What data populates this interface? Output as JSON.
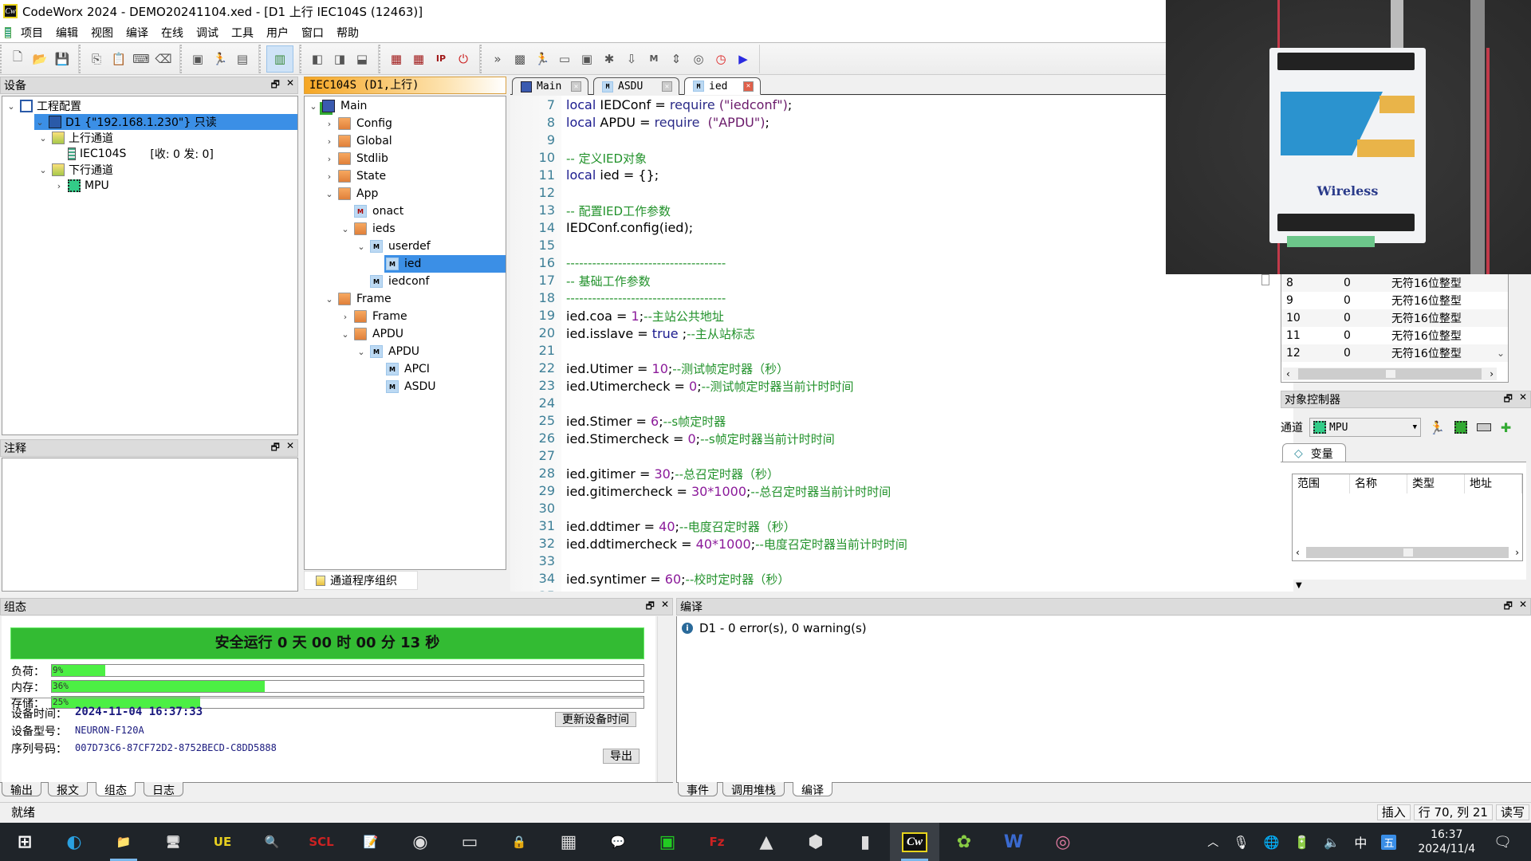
{
  "window": {
    "title": "CodeWorx 2024 - DEMO20241104.xed - [D1 上行 IEC104S (12463)]",
    "logo": "Cw"
  },
  "menu": [
    "项目",
    "编辑",
    "视图",
    "编译",
    "在线",
    "调试",
    "工具",
    "用户",
    "窗口",
    "帮助"
  ],
  "toolbar": {
    "groups": [
      [
        {
          "icon": "new-file-icon",
          "glyph": "🗋"
        },
        {
          "icon": "open-folder-icon",
          "glyph": "📂"
        },
        {
          "icon": "save-icon",
          "glyph": "💾"
        }
      ],
      [
        {
          "icon": "copy-icon",
          "glyph": "⎘"
        },
        {
          "icon": "paste-icon",
          "glyph": "📋"
        },
        {
          "icon": "keyboard-icon",
          "glyph": "⌨"
        },
        {
          "icon": "keyboard-delete-icon",
          "glyph": "⌫"
        }
      ],
      [
        {
          "icon": "add-module-icon",
          "glyph": "▣"
        },
        {
          "icon": "run-add-icon",
          "glyph": "🏃"
        },
        {
          "icon": "module-icon",
          "glyph": "▤"
        }
      ],
      [
        {
          "icon": "channel-list-icon",
          "glyph": "▥",
          "active": true
        }
      ],
      [
        {
          "icon": "layout-left-icon",
          "glyph": "◧"
        },
        {
          "icon": "layout-right-icon",
          "glyph": "◨"
        },
        {
          "icon": "layout-bottom-icon",
          "glyph": "⬓"
        }
      ],
      [
        {
          "icon": "device-connect-icon",
          "glyph": "▦"
        },
        {
          "icon": "device-disconnect-icon",
          "glyph": "▦"
        },
        {
          "icon": "ip-config-icon",
          "glyph": "IP"
        },
        {
          "icon": "power-icon",
          "glyph": "⏻"
        }
      ],
      [
        {
          "icon": "expand-icon",
          "glyph": "»"
        },
        {
          "icon": "binary-icon",
          "glyph": "▩"
        },
        {
          "icon": "run-icon",
          "glyph": "🏃"
        },
        {
          "icon": "chip-icon",
          "glyph": "▭"
        },
        {
          "icon": "chip-add-icon",
          "glyph": "▣"
        },
        {
          "icon": "debug-add-icon",
          "glyph": "✱"
        },
        {
          "icon": "download-icon",
          "glyph": "⇩"
        },
        {
          "icon": "module-m-icon",
          "glyph": "M"
        },
        {
          "icon": "step-icon",
          "glyph": "⇕"
        },
        {
          "icon": "watch-icon",
          "glyph": "◎"
        },
        {
          "icon": "clock-icon",
          "glyph": "◷"
        },
        {
          "icon": "play-icon",
          "glyph": "▶"
        }
      ]
    ]
  },
  "device_pane": {
    "title": "设备",
    "tree": [
      {
        "level": 0,
        "chev": "v",
        "icon": "project-config-icon",
        "label": "工程配置"
      },
      {
        "level": 1,
        "chev": "v",
        "icon": "device-icon",
        "label": "D1 {\"192.168.1.230\"}  只读",
        "selected": true
      },
      {
        "level": 2,
        "chev": "v",
        "icon": "uplink-folder-icon",
        "label": "上行通道"
      },
      {
        "level": 3,
        "chev": "",
        "icon": "channel-icon",
        "label": "IEC104S",
        "extra": "[收: 0 发: 0]"
      },
      {
        "level": 2,
        "chev": "v",
        "icon": "downlink-folder-icon",
        "label": "下行通道"
      },
      {
        "level": 3,
        "chev": ">",
        "icon": "mpu-chip-icon",
        "label": "MPU"
      }
    ]
  },
  "note_pane": {
    "title": "注释"
  },
  "program_pane": {
    "title": "IEC104S (D1,上行)",
    "tree": [
      {
        "level": 0,
        "chev": "v",
        "type": "main",
        "label": "Main"
      },
      {
        "level": 1,
        "chev": ">",
        "type": "folder",
        "label": "Config"
      },
      {
        "level": 1,
        "chev": ">",
        "type": "folder",
        "label": "Global"
      },
      {
        "level": 1,
        "chev": ">",
        "type": "folder",
        "label": "Stdlib"
      },
      {
        "level": 1,
        "chev": ">",
        "type": "folder",
        "label": "State"
      },
      {
        "level": 1,
        "chev": "v",
        "type": "folder",
        "label": "App"
      },
      {
        "level": 2,
        "chev": "",
        "type": "mred",
        "label": "onact"
      },
      {
        "level": 2,
        "chev": "v",
        "type": "folder",
        "label": "ieds"
      },
      {
        "level": 3,
        "chev": "v",
        "type": "m",
        "label": "userdef"
      },
      {
        "level": 4,
        "chev": "",
        "type": "m",
        "label": "ied",
        "selected": true
      },
      {
        "level": 3,
        "chev": "",
        "type": "m",
        "label": "iedconf"
      },
      {
        "level": 1,
        "chev": "v",
        "type": "folder",
        "label": "Frame"
      },
      {
        "level": 2,
        "chev": ">",
        "type": "folder",
        "label": "Frame"
      },
      {
        "level": 2,
        "chev": "v",
        "type": "folder",
        "label": "APDU"
      },
      {
        "level": 3,
        "chev": "v",
        "type": "m",
        "label": "APDU"
      },
      {
        "level": 4,
        "chev": "",
        "type": "m",
        "label": "APCI"
      },
      {
        "level": 4,
        "chev": "",
        "type": "m",
        "label": "ASDU"
      }
    ],
    "bottom_tab": "通道程序组织"
  },
  "editor": {
    "tabs": [
      {
        "label": "Main",
        "icon": "main-program-icon"
      },
      {
        "label": "ASDU",
        "icon": "module-file-icon"
      },
      {
        "label": "ied",
        "icon": "module-file-icon",
        "active": true
      }
    ],
    "lines": [
      {
        "n": 7,
        "parts": [
          [
            "kw",
            "local"
          ],
          [
            "",
            "IEDConf = "
          ],
          [
            "fn",
            "require"
          ],
          [
            "str",
            "(\"iedconf\")"
          ],
          [
            "",
            ";"
          ]
        ]
      },
      {
        "n": 8,
        "parts": [
          [
            "kw",
            "local"
          ],
          [
            "",
            "APDU = "
          ],
          [
            "fn",
            "require"
          ],
          [
            "str",
            " (\"APDU\")"
          ],
          [
            "",
            ";"
          ]
        ]
      },
      {
        "n": 9,
        "parts": []
      },
      {
        "n": 10,
        "parts": [
          [
            "cm",
            "-- 定义IED对象"
          ]
        ]
      },
      {
        "n": 11,
        "parts": [
          [
            "kw",
            "local"
          ],
          [
            "",
            "ied = {};"
          ]
        ]
      },
      {
        "n": 12,
        "parts": []
      },
      {
        "n": 13,
        "parts": [
          [
            "cm",
            "-- 配置IED工作参数"
          ]
        ]
      },
      {
        "n": 14,
        "parts": [
          [
            "",
            "IEDConf.config(ied);"
          ]
        ]
      },
      {
        "n": 15,
        "parts": []
      },
      {
        "n": 16,
        "parts": [
          [
            "cm",
            "-------------------------------------"
          ]
        ]
      },
      {
        "n": 17,
        "parts": [
          [
            "cm",
            "-- 基础工作参数"
          ]
        ]
      },
      {
        "n": 18,
        "parts": [
          [
            "cm",
            "-------------------------------------"
          ]
        ]
      },
      {
        "n": 19,
        "parts": [
          [
            "",
            "ied.coa = "
          ],
          [
            "num",
            "1"
          ],
          [
            "",
            ";"
          ],
          [
            "cm",
            "--主站公共地址"
          ]
        ]
      },
      {
        "n": 20,
        "parts": [
          [
            "",
            "ied.isslave = "
          ],
          [
            "kw",
            "true"
          ],
          [
            "",
            ";"
          ],
          [
            "cm",
            "--主从站标志"
          ]
        ]
      },
      {
        "n": 21,
        "parts": []
      },
      {
        "n": 22,
        "parts": [
          [
            "",
            "ied.Utimer = "
          ],
          [
            "num",
            "10"
          ],
          [
            "",
            ";"
          ],
          [
            "cm",
            "--测试帧定时器（秒）"
          ]
        ]
      },
      {
        "n": 23,
        "parts": [
          [
            "",
            "ied.Utimercheck = "
          ],
          [
            "num",
            "0"
          ],
          [
            "",
            ";"
          ],
          [
            "cm",
            "--测试帧定时器当前计时时间"
          ]
        ]
      },
      {
        "n": 24,
        "parts": []
      },
      {
        "n": 25,
        "parts": [
          [
            "",
            "ied.Stimer = "
          ],
          [
            "num",
            "6"
          ],
          [
            "",
            ";"
          ],
          [
            "cm",
            "--s帧定时器"
          ]
        ]
      },
      {
        "n": 26,
        "parts": [
          [
            "",
            "ied.Stimercheck = "
          ],
          [
            "num",
            "0"
          ],
          [
            "",
            ";"
          ],
          [
            "cm",
            "--s帧定时器当前计时时间"
          ]
        ]
      },
      {
        "n": 27,
        "parts": []
      },
      {
        "n": 28,
        "parts": [
          [
            "",
            "ied.gitimer = "
          ],
          [
            "num",
            "30"
          ],
          [
            "",
            ";"
          ],
          [
            "cm",
            "--总召定时器（秒）"
          ]
        ]
      },
      {
        "n": 29,
        "parts": [
          [
            "",
            "ied.gitimercheck = "
          ],
          [
            "num",
            "30*1000"
          ],
          [
            "",
            ";"
          ],
          [
            "cm",
            "--总召定时器当前计时时间"
          ]
        ]
      },
      {
        "n": 30,
        "parts": []
      },
      {
        "n": 31,
        "parts": [
          [
            "",
            "ied.ddtimer = "
          ],
          [
            "num",
            "40"
          ],
          [
            "",
            ";"
          ],
          [
            "cm",
            "--电度召定时器（秒）"
          ]
        ]
      },
      {
        "n": 32,
        "parts": [
          [
            "",
            "ied.ddtimercheck = "
          ],
          [
            "num",
            "40*1000"
          ],
          [
            "",
            ";"
          ],
          [
            "cm",
            "--电度召定时器当前计时时间"
          ]
        ]
      },
      {
        "n": 33,
        "parts": []
      },
      {
        "n": 34,
        "parts": [
          [
            "",
            "ied.syntimer = "
          ],
          [
            "num",
            "60"
          ],
          [
            "",
            ";"
          ],
          [
            "cm",
            "--校时定时器（秒）"
          ]
        ]
      }
    ]
  },
  "register_table": {
    "rows": [
      [
        "8",
        "0",
        "无符16位整型"
      ],
      [
        "9",
        "0",
        "无符16位整型"
      ],
      [
        "10",
        "0",
        "无符16位整型"
      ],
      [
        "11",
        "0",
        "无符16位整型"
      ],
      [
        "12",
        "0",
        "无符16位整型"
      ]
    ]
  },
  "object_controller": {
    "title": "对象控制器",
    "channel_label": "通道",
    "channel_value": "MPU",
    "tab": "变量",
    "columns": [
      "范围",
      "名称",
      "类型",
      "地址"
    ]
  },
  "status_pane": {
    "title": "组态",
    "uptime": "安全运行  0  天  00  时  00  分  13  秒",
    "bars": [
      {
        "label": "负荷：",
        "value": 9,
        "text": "9%"
      },
      {
        "label": "内存：",
        "value": 36,
        "text": "36%"
      },
      {
        "label": "存储：",
        "value": 25,
        "text": "25%"
      }
    ],
    "device_time_label": "设备时间：",
    "device_time": "2024-11-04 16:37:33",
    "model_label": "设备型号：",
    "model": "NEURON-F120A",
    "serial_label": "序列号码：",
    "serial": "007D73C6-87CF72D2-8752BECD-C8DD5888",
    "update_time_btn": "更新设备时间",
    "export_btn": "导出",
    "tabs": [
      "输出",
      "报文",
      "组态",
      "日志"
    ],
    "active_tab": 2
  },
  "compile_pane": {
    "title": "编译",
    "message": "D1 - 0 error(s), 0 warning(s)",
    "tabs": [
      "事件",
      "调用堆栈",
      "编译"
    ],
    "active_tab": 2
  },
  "statusbar": {
    "ready": "就绪",
    "mode": "插入",
    "position": "行 70, 列 21",
    "access": "读写"
  },
  "camera_overlay": {
    "device_brand": "Wireless"
  },
  "taskbar": {
    "apps": [
      {
        "name": "start-icon",
        "glyph": "⊞"
      },
      {
        "name": "edge-icon",
        "glyph": "◐"
      },
      {
        "name": "file-explorer-icon",
        "glyph": "📁",
        "running": true
      },
      {
        "name": "control-panel-icon",
        "glyph": "🖥"
      },
      {
        "name": "ultraedit-icon",
        "glyph": "UE"
      },
      {
        "name": "scan-tool-icon",
        "glyph": "🔍"
      },
      {
        "name": "scl-tool-icon",
        "glyph": "SCL"
      },
      {
        "name": "notepad-plus-icon",
        "glyph": "📝"
      },
      {
        "name": "media-icon",
        "glyph": "◉"
      },
      {
        "name": "monitor-icon",
        "glyph": "▭"
      },
      {
        "name": "lock-app-icon",
        "glyph": "🔒"
      },
      {
        "name": "calculator-icon",
        "glyph": "▦"
      },
      {
        "name": "wechat-icon",
        "glyph": "💬"
      },
      {
        "name": "expert-icon",
        "glyph": "▣"
      },
      {
        "name": "filezilla-icon",
        "glyph": "Fz"
      },
      {
        "name": "triangle-app-icon",
        "glyph": "▲"
      },
      {
        "name": "cube-app-icon",
        "glyph": "⬢"
      },
      {
        "name": "archive-app-icon",
        "glyph": "▮"
      },
      {
        "name": "codeworx-icon",
        "glyph": "Cw",
        "active": true
      },
      {
        "name": "green-app-icon",
        "glyph": "✿"
      },
      {
        "name": "word-icon",
        "glyph": "W"
      },
      {
        "name": "camera-app-icon",
        "glyph": "◎"
      }
    ],
    "tray": {
      "ime_lang": "中",
      "ime_mode": "五",
      "time": "16:37",
      "date": "2024/11/4"
    }
  }
}
